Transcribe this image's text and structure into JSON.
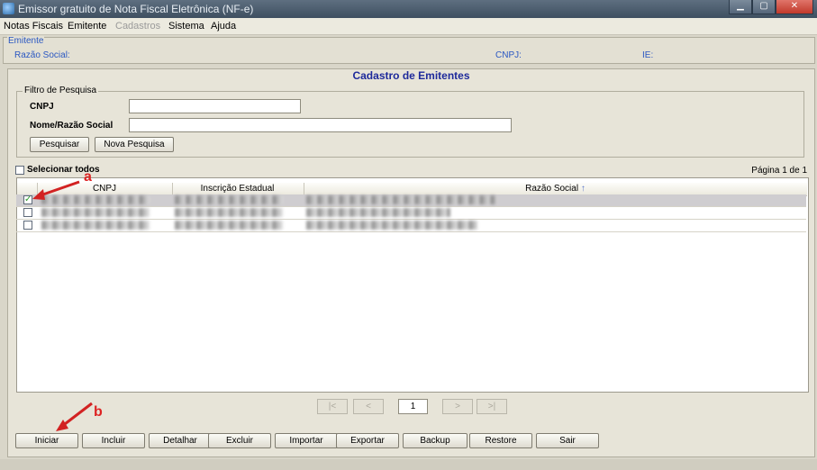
{
  "window": {
    "title": "Emissor gratuito de Nota Fiscal Eletrônica (NF-e)"
  },
  "menu": [
    {
      "label": "Notas Fiscais",
      "enabled": true
    },
    {
      "label": "Emitente",
      "enabled": true
    },
    {
      "label": "Cadastros",
      "enabled": false
    },
    {
      "label": "Sistema",
      "enabled": true
    },
    {
      "label": "Ajuda",
      "enabled": true
    }
  ],
  "emitente": {
    "legend": "Emitente",
    "razao_label": "Razão Social:",
    "cnpj_label": "CNPJ:",
    "ie_label": "IE:"
  },
  "cadastro": {
    "title": "Cadastro de Emitentes",
    "filter": {
      "legend": "Filtro de Pesquisa",
      "cnpj_label": "CNPJ",
      "nome_label": "Nome/Razão Social",
      "cnpj_value": "",
      "nome_value": "",
      "pesquisar_label": "Pesquisar",
      "nova_label": "Nova Pesquisa"
    },
    "select_all_label": "Selecionar todos",
    "page_info": "Página 1 de 1",
    "columns": [
      "CNPJ",
      "Inscrição Estadual",
      "Razão Social"
    ],
    "sort_indicator": "↑",
    "rows": [
      {
        "checked": true,
        "selected": true
      },
      {
        "checked": false,
        "selected": false
      },
      {
        "checked": false,
        "selected": false
      }
    ],
    "pager": {
      "first": "|<",
      "prev": "<",
      "page": "1",
      "next": ">",
      "last": ">|"
    }
  },
  "actions": [
    "Iniciar",
    "Incluir",
    "Detalhar",
    "Excluir",
    "Importar",
    "Exportar",
    "Backup",
    "Restore",
    "Sair"
  ],
  "annotations": {
    "a": "a",
    "b": "b"
  },
  "colors": {
    "accent_blue": "#1e2a9b",
    "annotation_red": "#d22222"
  }
}
